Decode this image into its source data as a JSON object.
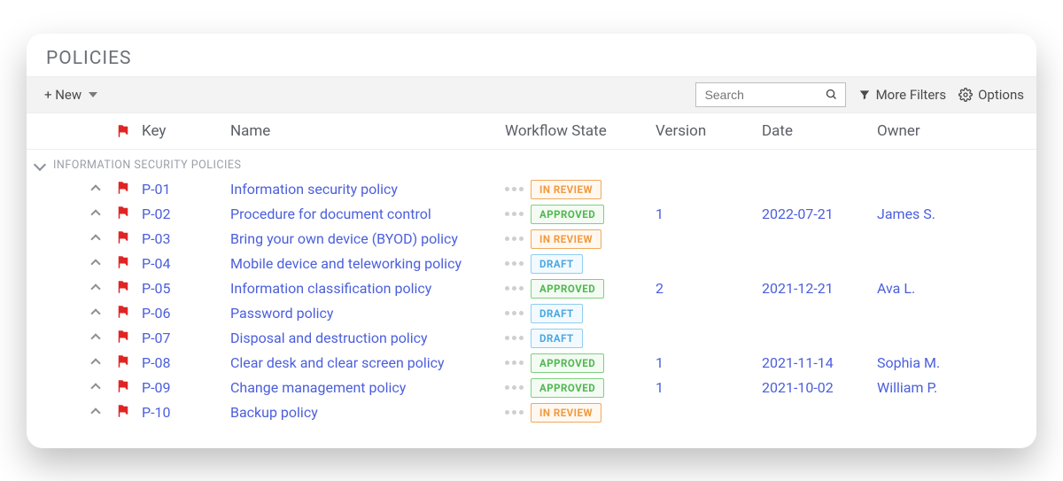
{
  "title": "POLICIES",
  "toolbar": {
    "new_label": "+ New",
    "search_placeholder": "Search",
    "filters_label": "More Filters",
    "options_label": "Options"
  },
  "columns": {
    "key": "Key",
    "name": "Name",
    "state": "Workflow State",
    "version": "Version",
    "date": "Date",
    "owner": "Owner"
  },
  "group": {
    "label": "INFORMATION SECURITY POLICIES"
  },
  "states": {
    "in_review": "IN REVIEW",
    "approved": "APPROVED",
    "draft": "DRAFT"
  },
  "rows": [
    {
      "key": "P-01",
      "name": "Information security policy",
      "state": "in_review",
      "version": "",
      "date": "",
      "owner": ""
    },
    {
      "key": "P-02",
      "name": "Procedure for document control",
      "state": "approved",
      "version": "1",
      "date": "2022-07-21",
      "owner": "James S."
    },
    {
      "key": "P-03",
      "name": "Bring your own device (BYOD) policy",
      "state": "in_review",
      "version": "",
      "date": "",
      "owner": ""
    },
    {
      "key": "P-04",
      "name": "Mobile device and teleworking policy",
      "state": "draft",
      "version": "",
      "date": "",
      "owner": ""
    },
    {
      "key": "P-05",
      "name": "Information classification policy",
      "state": "approved",
      "version": "2",
      "date": "2021-12-21",
      "owner": "Ava L."
    },
    {
      "key": "P-06",
      "name": "Password policy",
      "state": "draft",
      "version": "",
      "date": "",
      "owner": ""
    },
    {
      "key": "P-07",
      "name": "Disposal and destruction policy",
      "state": "draft",
      "version": "",
      "date": "",
      "owner": ""
    },
    {
      "key": "P-08",
      "name": "Clear desk and clear screen policy",
      "state": "approved",
      "version": "1",
      "date": "2021-11-14",
      "owner": "Sophia M."
    },
    {
      "key": "P-09",
      "name": "Change management policy",
      "state": "approved",
      "version": "1",
      "date": "2021-10-02",
      "owner": "William P."
    },
    {
      "key": "P-10",
      "name": "Backup policy",
      "state": "in_review",
      "version": "",
      "date": "",
      "owner": ""
    }
  ]
}
